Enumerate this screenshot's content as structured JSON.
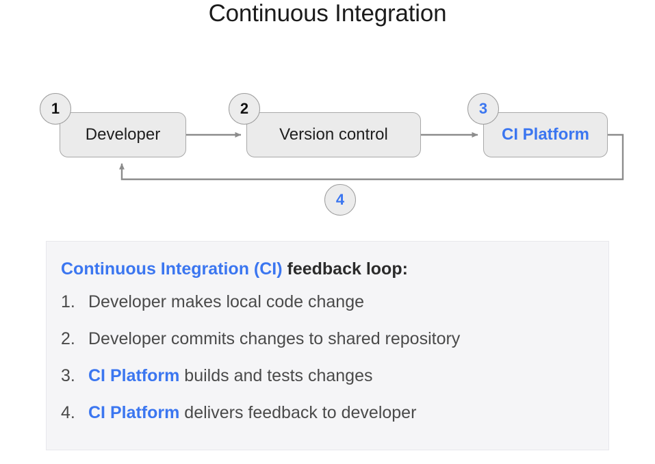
{
  "title": "Continuous Integration",
  "colors": {
    "accent_blue": "#3b76f0",
    "node_fill": "#ebebeb",
    "node_border": "#a8a8a8",
    "arrow": "#8c8c8c",
    "panel_bg": "#f5f5f7",
    "text_dark": "#1e1e1e",
    "text_body": "#4a4a4a"
  },
  "diagram": {
    "nodes": [
      {
        "id": "developer",
        "label": "Developer",
        "badge": "1",
        "accent": false
      },
      {
        "id": "version",
        "label": "Version control",
        "badge": "2",
        "accent": false
      },
      {
        "id": "ciplatform",
        "label": "CI Platform",
        "badge": "3",
        "accent": true
      }
    ],
    "loop_badge": "4"
  },
  "legend": {
    "heading_accent": "Continuous Integration (CI)",
    "heading_rest": " feedback loop:",
    "items": [
      {
        "num": "1.",
        "accent": "",
        "text": "Developer makes local code change"
      },
      {
        "num": "2.",
        "accent": "",
        "text": "Developer commits changes to shared repository"
      },
      {
        "num": "3.",
        "accent": "CI Platform",
        "text": " builds and tests changes"
      },
      {
        "num": "4.",
        "accent": "CI Platform",
        "text": " delivers feedback to developer"
      }
    ]
  }
}
